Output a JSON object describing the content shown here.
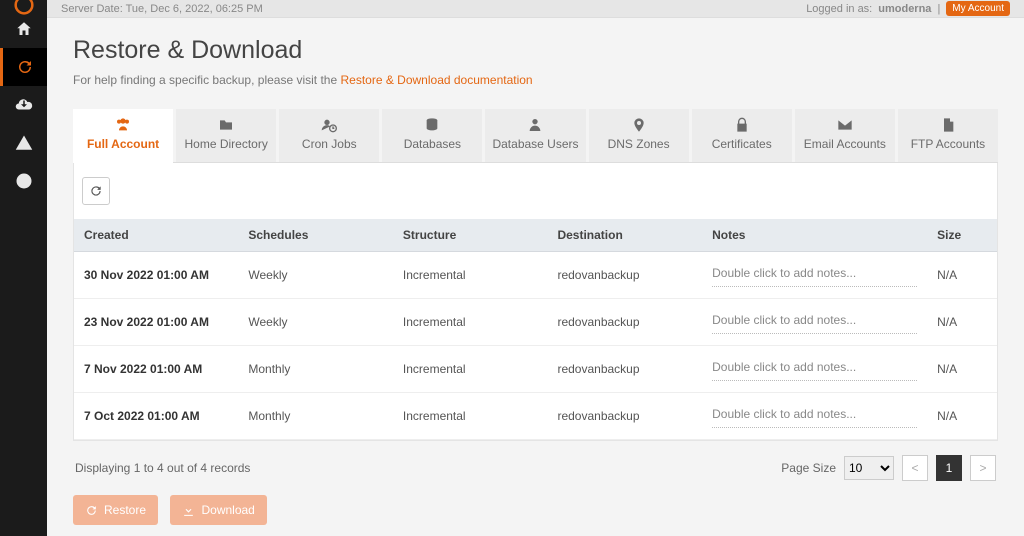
{
  "topbar": {
    "server_date_label": "Server Date:",
    "server_date_value": "Tue, Dec 6, 2022, 06:25 PM",
    "logged_in_label": "Logged in as:",
    "username": "umoderna",
    "my_account_label": "My Account"
  },
  "page": {
    "title": "Restore & Download",
    "help_prefix": "For help finding a specific backup, please visit the ",
    "help_link_text": "Restore & Download documentation"
  },
  "tabs": [
    {
      "id": "full-account",
      "label": "Full Account",
      "active": true
    },
    {
      "id": "home-directory",
      "label": "Home Directory",
      "active": false
    },
    {
      "id": "cron-jobs",
      "label": "Cron Jobs",
      "active": false
    },
    {
      "id": "databases",
      "label": "Databases",
      "active": false
    },
    {
      "id": "database-users",
      "label": "Database Users",
      "active": false
    },
    {
      "id": "dns-zones",
      "label": "DNS Zones",
      "active": false
    },
    {
      "id": "certificates",
      "label": "Certificates",
      "active": false
    },
    {
      "id": "email-accounts",
      "label": "Email Accounts",
      "active": false
    },
    {
      "id": "ftp-accounts",
      "label": "FTP Accounts",
      "active": false
    }
  ],
  "columns": {
    "created": "Created",
    "schedules": "Schedules",
    "structure": "Structure",
    "destination": "Destination",
    "notes": "Notes",
    "size": "Size"
  },
  "rows": [
    {
      "created": "30 Nov 2022 01:00 AM",
      "schedules": "Weekly",
      "structure": "Incremental",
      "destination": "redovanbackup",
      "notes_placeholder": "Double click to add notes...",
      "size": "N/A"
    },
    {
      "created": "23 Nov 2022 01:00 AM",
      "schedules": "Weekly",
      "structure": "Incremental",
      "destination": "redovanbackup",
      "notes_placeholder": "Double click to add notes...",
      "size": "N/A"
    },
    {
      "created": "7 Nov 2022 01:00 AM",
      "schedules": "Monthly",
      "structure": "Incremental",
      "destination": "redovanbackup",
      "notes_placeholder": "Double click to add notes...",
      "size": "N/A"
    },
    {
      "created": "7 Oct 2022 01:00 AM",
      "schedules": "Monthly",
      "structure": "Incremental",
      "destination": "redovanbackup",
      "notes_placeholder": "Double click to add notes...",
      "size": "N/A"
    }
  ],
  "footer": {
    "display_text": "Displaying 1 to 4 out of 4 records",
    "page_size_label": "Page Size",
    "page_size_value": "10",
    "prev": "<",
    "current_page": "1",
    "next": ">"
  },
  "actions": {
    "restore": "Restore",
    "download": "Download"
  }
}
